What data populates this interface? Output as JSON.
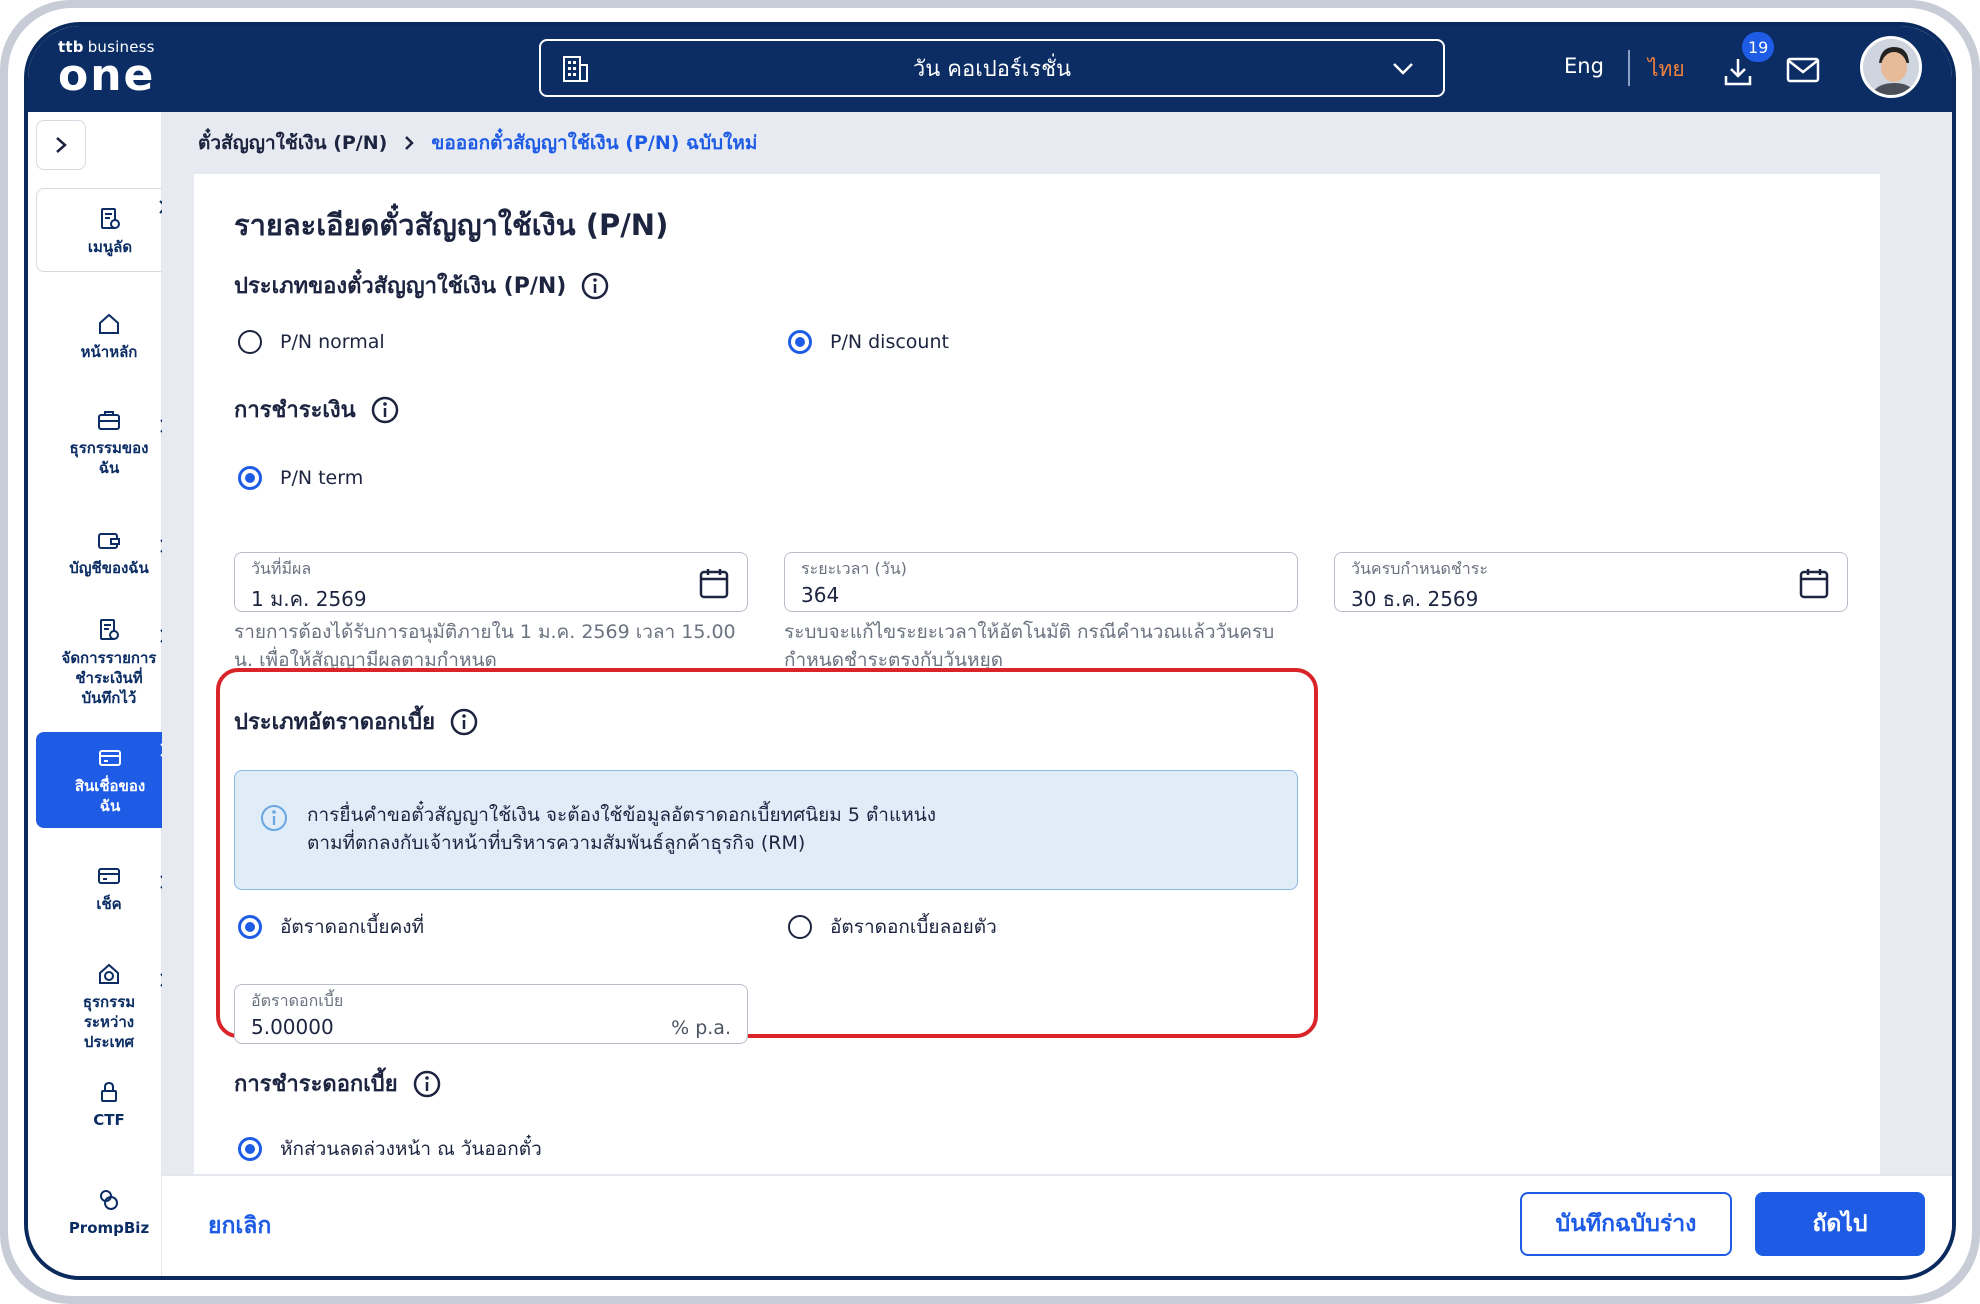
{
  "header": {
    "logo_small": "business",
    "logo_brand": "ttb",
    "logo_big": "one",
    "company": "วัน คอเปอร์เรชั่น",
    "lang_eng": "Eng",
    "lang_thai": "ไทย",
    "download_badge": "19",
    "icons": [
      "building-icon",
      "chevron-down-icon",
      "download-icon",
      "mail-icon",
      "avatar"
    ]
  },
  "sidebar": {
    "items": [
      {
        "label": "เมนูลัด",
        "icon": "shortcut-icon"
      },
      {
        "label": "หน้าหลัก",
        "icon": "home-icon"
      },
      {
        "label": "ธุรกรรมของฉัน",
        "icon": "briefcase-icon"
      },
      {
        "label": "บัญชีของฉัน",
        "icon": "wallet-icon"
      },
      {
        "label": "จัดการรายการชำระเงินที่บันทึกไว้",
        "icon": "document-icon"
      },
      {
        "label": "สินเชื่อของฉัน",
        "icon": "loan-icon"
      },
      {
        "label": "เช็ค",
        "icon": "cheque-icon"
      },
      {
        "label": "ธุรกรรมระหว่างประเทศ",
        "icon": "international-icon"
      },
      {
        "label": "CTF",
        "icon": "lock-icon"
      },
      {
        "label": "PrompBiz",
        "icon": "prompbiz-icon"
      }
    ]
  },
  "breadcrumb": {
    "parent": "ตั๋วสัญญาใช้เงิน (P/N)",
    "current": "ขอออกตั๋วสัญญาใช้เงิน (P/N) ฉบับใหม่"
  },
  "form": {
    "title": "รายละเอียดตั๋วสัญญาใช้เงิน (P/N)",
    "pn_type": {
      "heading": "ประเภทของตั๋วสัญญาใช้เงิน (P/N)",
      "options": [
        "P/N normal",
        "P/N discount"
      ],
      "selected": "P/N discount"
    },
    "payment": {
      "heading": "การชำระเงิน",
      "option": "P/N term"
    },
    "effective_date": {
      "label": "วันที่มีผล",
      "value": "1 ม.ค. 2569",
      "hint": "รายการต้องได้รับการอนุมัติภายใน 1 ม.ค. 2569 เวลา 15.00 น. เพื่อให้สัญญามีผลตามกำหนด"
    },
    "duration": {
      "label": "ระยะเวลา (วัน)",
      "value": "364",
      "hint": "ระบบจะแก้ไขระยะเวลาให้อัตโนมัติ กรณีคำนวณแล้ววันครบกำหนดชำระตรงกับวันหยุด"
    },
    "due_date": {
      "label": "วันครบกำหนดชำระ",
      "value": "30 ธ.ค. 2569"
    },
    "interest_type": {
      "heading": "ประเภทอัตราดอกเบี้ย",
      "notice_line1": "การยื่นคำขอตั๋วสัญญาใช้เงิน จะต้องใช้ข้อมูลอัตราดอกเบี้ยทศนิยม 5 ตำแหน่ง",
      "notice_line2": "ตามที่ตกลงกับเจ้าหน้าที่บริหารความสัมพันธ์ลูกค้าธุรกิจ (RM)",
      "options": [
        "อัตราดอกเบี้ยคงที่",
        "อัตราดอกเบี้ยลอยตัว"
      ],
      "selected": "อัตราดอกเบี้ยคงที่"
    },
    "interest_rate": {
      "label": "อัตราดอกเบี้ย",
      "value": "5.00000",
      "unit": "% p.a."
    },
    "interest_payment": {
      "heading": "การชำระดอกเบี้ย",
      "option": "หักส่วนลดล่วงหน้า ณ วันออกตั๋ว"
    }
  },
  "footer": {
    "cancel": "ยกเลิก",
    "save_draft": "บันทึกฉบับร่าง",
    "next": "ถัดไป"
  },
  "colors": {
    "header_bg": "#0b2d64",
    "accent": "#1f5ce6",
    "highlight": "#d9252a",
    "thai_lang": "#f1813a"
  }
}
